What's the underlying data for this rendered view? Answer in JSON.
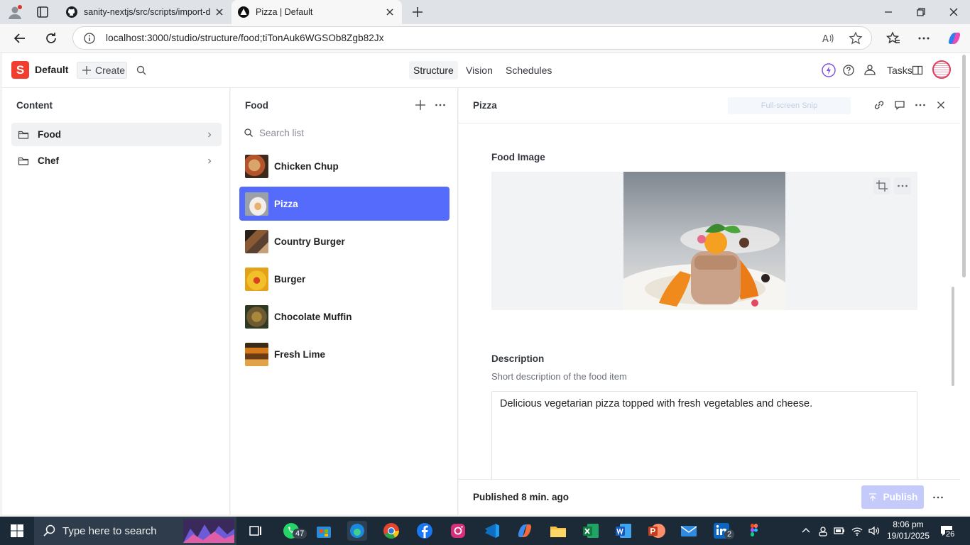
{
  "browser": {
    "tabs": [
      {
        "title": "sanity-nextjs/src/scripts/import-d"
      },
      {
        "title": "Pizza | Default"
      }
    ],
    "url": "localhost:3000/studio/structure/food;tiTonAuk6WGSOb8Zgb82Jx"
  },
  "studio": {
    "workspace": "Default",
    "create_label": "Create",
    "nav_tabs": [
      "Structure",
      "Vision",
      "Schedules"
    ],
    "tasks_label": "Tasks"
  },
  "content_pane": {
    "title": "Content",
    "items": [
      {
        "label": "Food"
      },
      {
        "label": "Chef"
      }
    ]
  },
  "food_pane": {
    "title": "Food",
    "search_placeholder": "Search list",
    "items": [
      {
        "label": "Chicken Chup",
        "color": "#b5532c"
      },
      {
        "label": "Pizza",
        "color": "#c9b9a0"
      },
      {
        "label": "Country Burger",
        "color": "#5a4030"
      },
      {
        "label": "Burger",
        "color": "#e3a21a"
      },
      {
        "label": "Chocolate Muffin",
        "color": "#6e5a30"
      },
      {
        "label": "Fresh Lime",
        "color": "#d47a1a"
      }
    ]
  },
  "document": {
    "title": "Pizza",
    "snip_overlay": "Full-screen Snip",
    "image_field": {
      "label": "Food Image"
    },
    "description_field": {
      "label": "Description",
      "help": "Short description of the food item",
      "value": "Delicious vegetarian pizza topped with fresh vegetables and cheese."
    },
    "status_prefix": "Published",
    "status_time": "8 min. ago",
    "publish_label": "Publish"
  },
  "taskbar": {
    "search_placeholder": "Type here to search",
    "whatsapp_badge": "47",
    "linkedin_badge": "2",
    "time": "8:06 pm",
    "date": "19/01/2025",
    "notifications": "26"
  },
  "colors": {
    "accent": "#556bfc",
    "brand": "#f03e2f"
  }
}
